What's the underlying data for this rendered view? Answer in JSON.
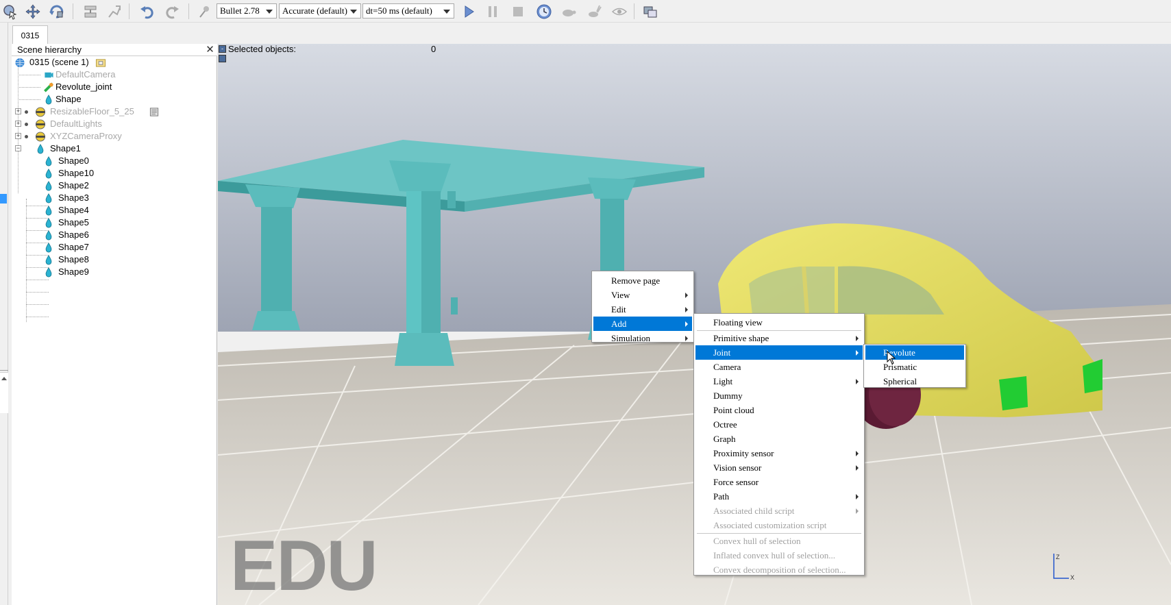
{
  "toolbar": {
    "engine_combo": "Bullet 2.78",
    "accuracy_combo": "Accurate (default)",
    "timestep_combo": "dt=50 ms (default)"
  },
  "tabs": [
    {
      "label": "0315"
    }
  ],
  "hierarchy": {
    "title": "Scene hierarchy",
    "close": "✕",
    "items": [
      {
        "label": "0315 (scene 1)"
      },
      {
        "label": "DefaultCamera"
      },
      {
        "label": "Revolute_joint"
      },
      {
        "label": "Shape"
      },
      {
        "label": "ResizableFloor_5_25"
      },
      {
        "label": "DefaultLights"
      },
      {
        "label": "XYZCameraProxy"
      },
      {
        "label": "Shape1"
      },
      {
        "label": "Shape0"
      },
      {
        "label": "Shape10"
      },
      {
        "label": "Shape2"
      },
      {
        "label": "Shape3"
      },
      {
        "label": "Shape4"
      },
      {
        "label": "Shape5"
      },
      {
        "label": "Shape6"
      },
      {
        "label": "Shape7"
      },
      {
        "label": "Shape8"
      },
      {
        "label": "Shape9"
      }
    ]
  },
  "viewport": {
    "selected_label": "Selected objects:",
    "selected_count": "0",
    "watermark": "EDU",
    "axis_z": "Z",
    "axis_x": "X"
  },
  "context_menu": {
    "items": [
      "Remove page",
      "View",
      "Edit",
      "Add",
      "Simulation"
    ]
  },
  "add_menu": {
    "items": [
      "Floating view",
      "Primitive shape",
      "Joint",
      "Camera",
      "Light",
      "Dummy",
      "Point cloud",
      "Octree",
      "Graph",
      "Proximity sensor",
      "Vision sensor",
      "Force sensor",
      "Path",
      "Associated child script",
      "Associated customization script",
      "Convex hull of selection",
      "Inflated convex hull of selection...",
      "Convex decomposition of selection..."
    ]
  },
  "joint_menu": {
    "items": [
      "Revolute",
      "Prismatic",
      "Spherical"
    ]
  },
  "colors": {
    "selection": "#0078d7",
    "table": "#5bbcbc",
    "car_body": "#e8e060",
    "wheel": "#5a1a33",
    "bumper": "#22cc33"
  }
}
